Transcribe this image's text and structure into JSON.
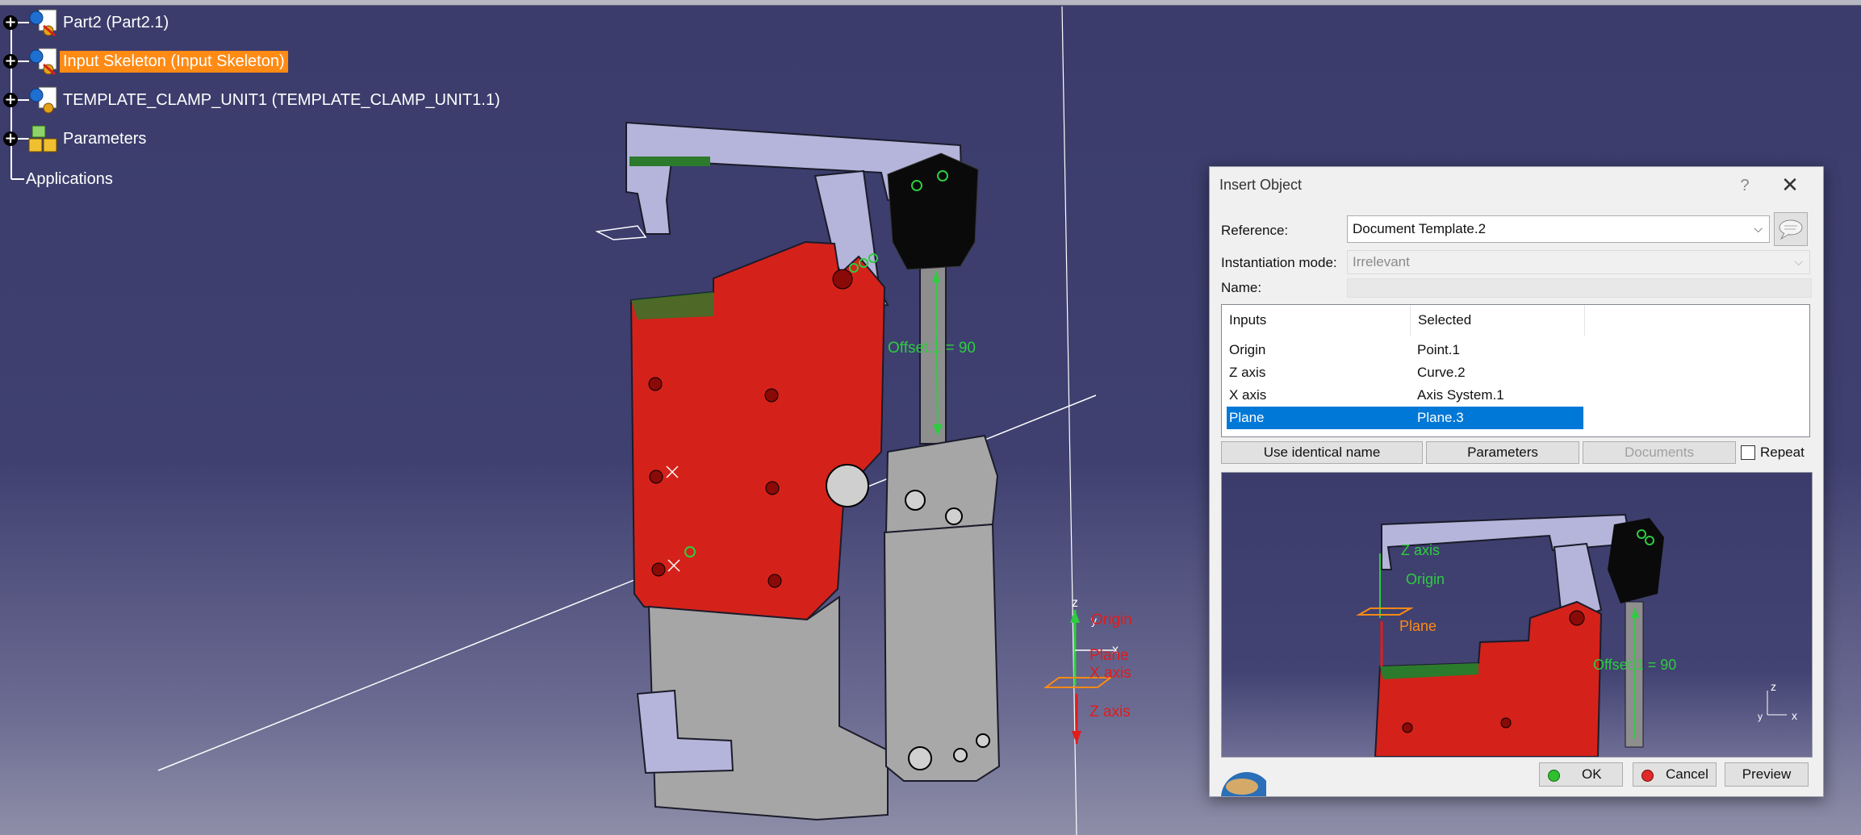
{
  "spec_tree": {
    "items": [
      {
        "label": "Part2 (Part2.1)",
        "icon": "part-icon",
        "expandable": true
      },
      {
        "label": "Input Skeleton (Input Skeleton)",
        "icon": "part-icon",
        "expandable": true,
        "selected": true
      },
      {
        "label": "TEMPLATE_CLAMP_UNIT1 (TEMPLATE_CLAMP_UNIT1.1)",
        "icon": "part-icon",
        "expandable": true
      },
      {
        "label": "Parameters",
        "icon": "parameters-icon",
        "expandable": true
      },
      {
        "label": "Applications",
        "icon": "",
        "expandable": false
      }
    ]
  },
  "viewport": {
    "labels": {
      "offset": "Offset.1 = 90",
      "origin": "Origin",
      "plane": "Plane",
      "x_axis": "X axis",
      "z_axis": "Z axis",
      "z": "z",
      "x": "x",
      "y": "y"
    },
    "colors": {
      "background": "#3b3c6b",
      "part_red": "#d4221a",
      "part_lavender": "#b5b5db",
      "gray": "#a6a6a6",
      "highlight": "#ff8a14"
    }
  },
  "dialog": {
    "title": "Insert Object",
    "help": "?",
    "close": "✕",
    "reference_label": "Reference:",
    "reference_value": "Document Template.2",
    "instantiation_label": "Instantiation mode:",
    "instantiation_value": "Irrelevant",
    "name_label": "Name:",
    "name_value": "",
    "table": {
      "headers": [
        "Inputs",
        "Selected"
      ],
      "rows": [
        {
          "input": "Origin",
          "selected": "Point.1"
        },
        {
          "input": "Z axis",
          "selected": "Curve.2"
        },
        {
          "input": "X axis",
          "selected": "Axis System.1"
        },
        {
          "input": "Plane",
          "selected": "Plane.3",
          "highlighted": true
        }
      ]
    },
    "buttons": {
      "use_identical_name": "Use identical name",
      "parameters": "Parameters",
      "documents": "Documents",
      "repeat": "Repeat",
      "ok": "OK",
      "cancel": "Cancel",
      "preview": "Preview"
    },
    "preview_labels": {
      "z_axis": "Z axis",
      "origin": "Origin",
      "plane": "Plane",
      "offset": "Offset.1 = 90",
      "z": "z",
      "x": "x",
      "y": "y"
    }
  }
}
